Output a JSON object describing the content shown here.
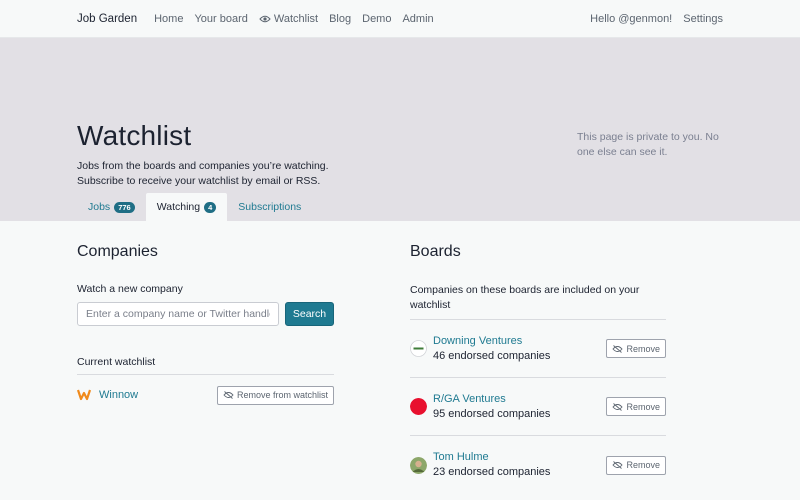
{
  "nav": {
    "brand": "Job Garden",
    "links": [
      "Home",
      "Your board",
      "Watchlist",
      "Blog",
      "Demo",
      "Admin"
    ],
    "hello": "Hello @genmon!",
    "settings": "Settings"
  },
  "hero": {
    "title": "Watchlist",
    "intro_line1": "Jobs from the boards and companies you’re watching.",
    "intro_line2": "Subscribe to receive your watchlist by email or RSS.",
    "private_note": "This page is private to you. No one else can see it."
  },
  "tabs": [
    {
      "label": "Jobs",
      "count": "776"
    },
    {
      "label": "Watching",
      "count": "4"
    },
    {
      "label": "Subscriptions"
    }
  ],
  "companies": {
    "heading": "Companies",
    "watch_label": "Watch a new company",
    "search_placeholder": "Enter a company name or Twitter handle",
    "search_button": "Search",
    "current_label": "Current watchlist",
    "items": [
      {
        "name": "Winnow",
        "action": "Remove from watchlist"
      }
    ]
  },
  "boards": {
    "heading": "Boards",
    "intro": "Companies on these boards are included on your watchlist",
    "items": [
      {
        "name": "Downing Ventures",
        "count": "46 endorsed companies",
        "action": "Remove"
      },
      {
        "name": "R/GA Ventures",
        "count": "95 endorsed companies",
        "action": "Remove"
      },
      {
        "name": "Tom Hulme",
        "count": "23 endorsed companies",
        "action": "Remove"
      }
    ]
  },
  "colors": {
    "accent": "#1f7a91",
    "hero_bg": "#e2e0e5",
    "rga_red": "#e8102e"
  }
}
